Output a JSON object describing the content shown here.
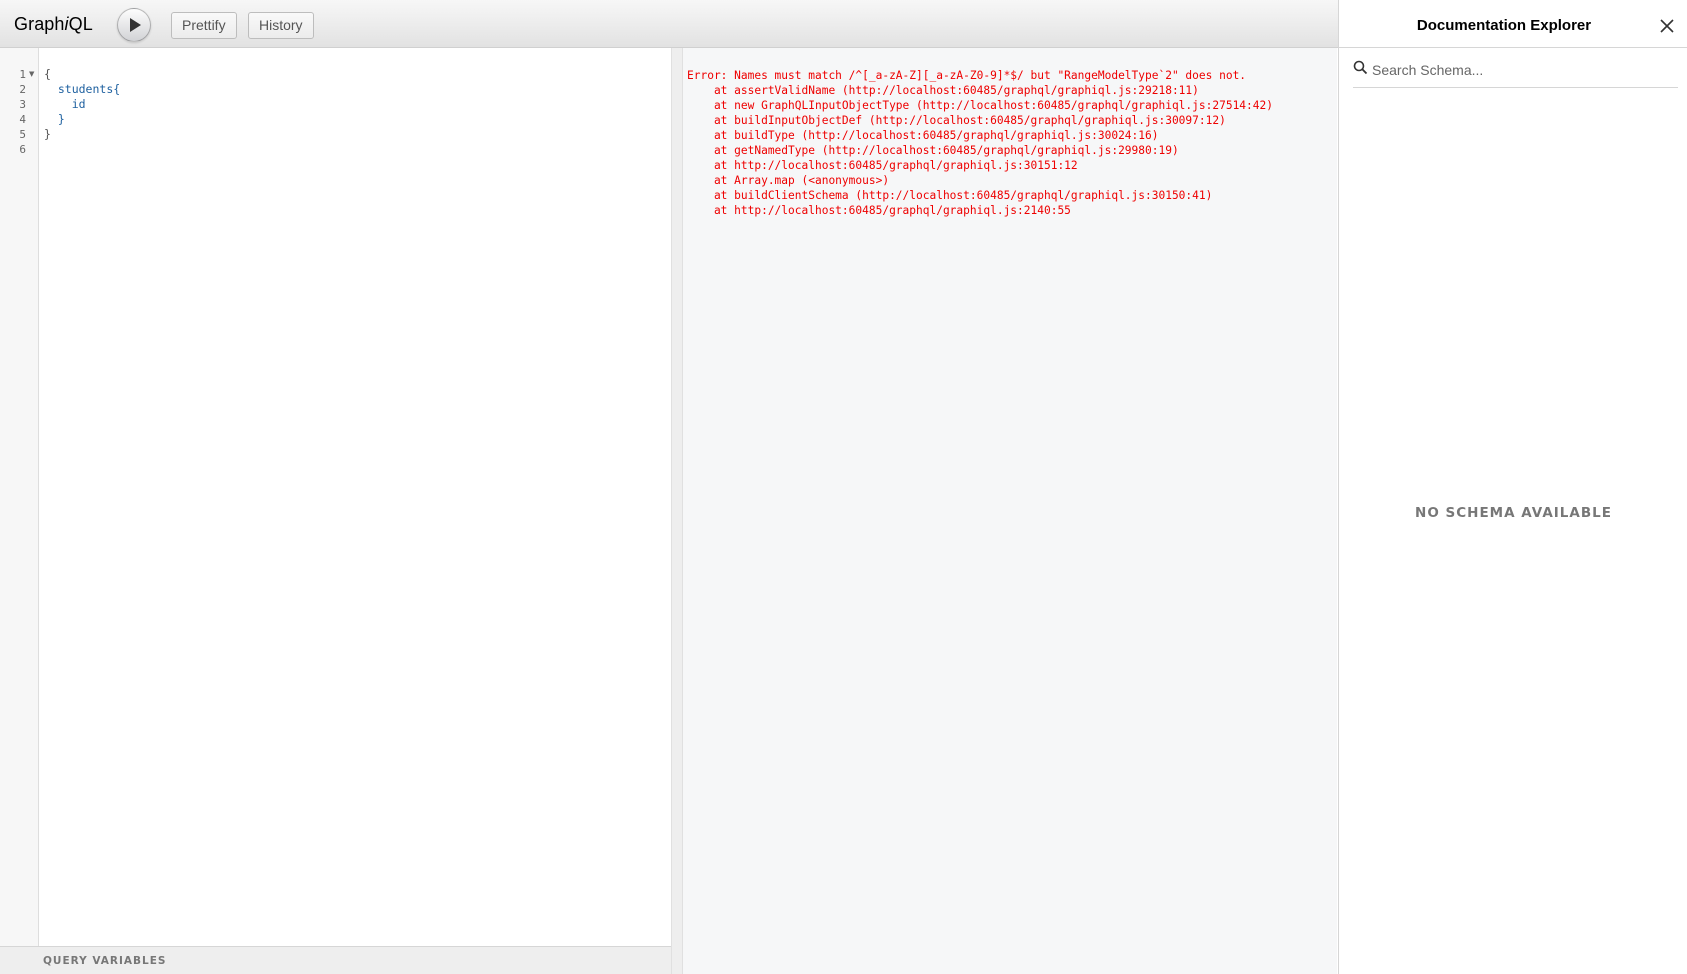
{
  "toolbar": {
    "logo_prefix": "Graph",
    "logo_italic": "i",
    "logo_suffix": "QL",
    "run_icon": "play-icon",
    "prettify_label": "Prettify",
    "history_label": "History"
  },
  "editor": {
    "line_numbers": [
      "1",
      "2",
      "3",
      "4",
      "5",
      "6"
    ],
    "lines": [
      {
        "indent": "",
        "text": "{"
      },
      {
        "indent": "  ",
        "text": "students{"
      },
      {
        "indent": "    ",
        "text": "id"
      },
      {
        "indent": "  ",
        "text": "}"
      },
      {
        "indent": "",
        "text": "}"
      },
      {
        "indent": "",
        "text": ""
      }
    ],
    "query_variables_label": "QUERY VARIABLES"
  },
  "result": {
    "error_lines": [
      "Error: Names must match /^[_a-zA-Z][_a-zA-Z0-9]*$/ but \"RangeModelType`2\" does not.",
      "    at assertValidName (http://localhost:60485/graphql/graphiql.js:29218:11)",
      "    at new GraphQLInputObjectType (http://localhost:60485/graphql/graphiql.js:27514:42)",
      "    at buildInputObjectDef (http://localhost:60485/graphql/graphiql.js:30097:12)",
      "    at buildType (http://localhost:60485/graphql/graphiql.js:30024:16)",
      "    at getNamedType (http://localhost:60485/graphql/graphiql.js:29980:19)",
      "    at http://localhost:60485/graphql/graphiql.js:30151:12",
      "    at Array.map (<anonymous>)",
      "    at buildClientSchema (http://localhost:60485/graphql/graphiql.js:30150:41)",
      "    at http://localhost:60485/graphql/graphiql.js:2140:55"
    ],
    "error_color": "#ee0000"
  },
  "doc_explorer": {
    "title": "Documentation Explorer",
    "close_icon": "close-icon",
    "search_placeholder": "Search Schema...",
    "search_icon": "search-icon",
    "empty_message": "NO SCHEMA AVAILABLE"
  }
}
